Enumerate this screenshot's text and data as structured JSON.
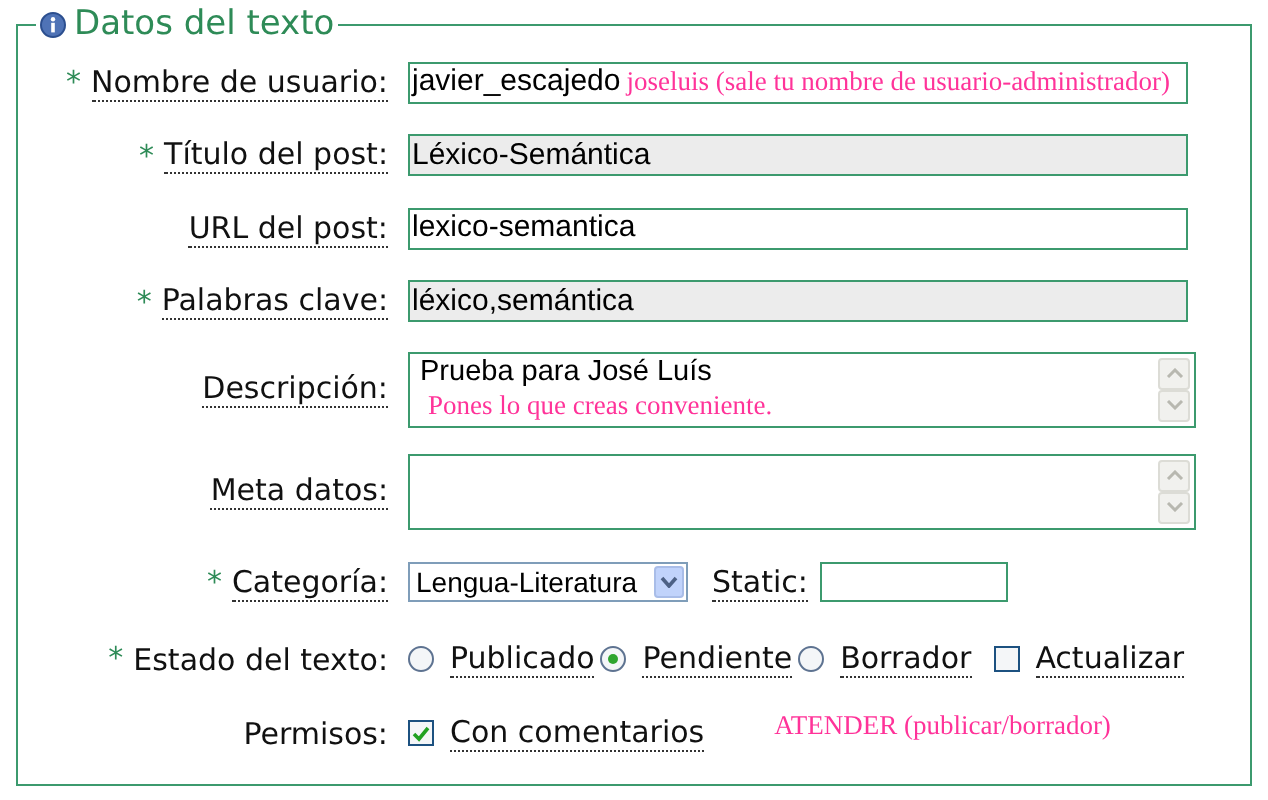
{
  "legend": "Datos del texto",
  "rows": [
    {
      "kind": "text",
      "label": "Nombre de usuario:",
      "marker": "*",
      "value": "javier_escajedo",
      "readonly": false,
      "note": "joseluis (sale tu nombre de usuario-administrador)"
    },
    {
      "kind": "text",
      "label": "Título del post:",
      "marker": "*",
      "value": "Léxico-Semántica",
      "readonly": true
    },
    {
      "kind": "text",
      "label": "URL del post:",
      "value": "lexico-semantica",
      "readonly": false
    },
    {
      "kind": "text",
      "label": "Palabras clave:",
      "marker": "*",
      "value": "léxico,semántica",
      "readonly": true
    },
    {
      "kind": "textarea",
      "label": "Descripción:",
      "value": "Prueba para José Luís",
      "note": "Pones lo que creas conveniente."
    },
    {
      "kind": "textarea",
      "label": "Meta datos:"
    },
    {
      "kind": "select",
      "label": "Categoría:",
      "marker": "*",
      "value": "Lengua-Literatura",
      "extra_label": "Static:"
    },
    {
      "kind": "options",
      "label": "Estado del texto:",
      "marker": "*",
      "underline": false,
      "options": [
        {
          "kind": "radio",
          "label": "Publicado",
          "selected": false
        },
        {
          "kind": "radio",
          "label": "Pendiente",
          "selected": true
        },
        {
          "kind": "radio",
          "label": "Borrador",
          "selected": false
        },
        {
          "kind": "checkbox",
          "label": "Actualizar",
          "checked": false
        }
      ]
    },
    {
      "kind": "options",
      "label": "Permisos:",
      "underline": false,
      "options": [
        {
          "kind": "checkbox",
          "label": "Con comentarios",
          "checked": true
        }
      ],
      "note": "ATENDER (publicar/borrador)"
    }
  ]
}
